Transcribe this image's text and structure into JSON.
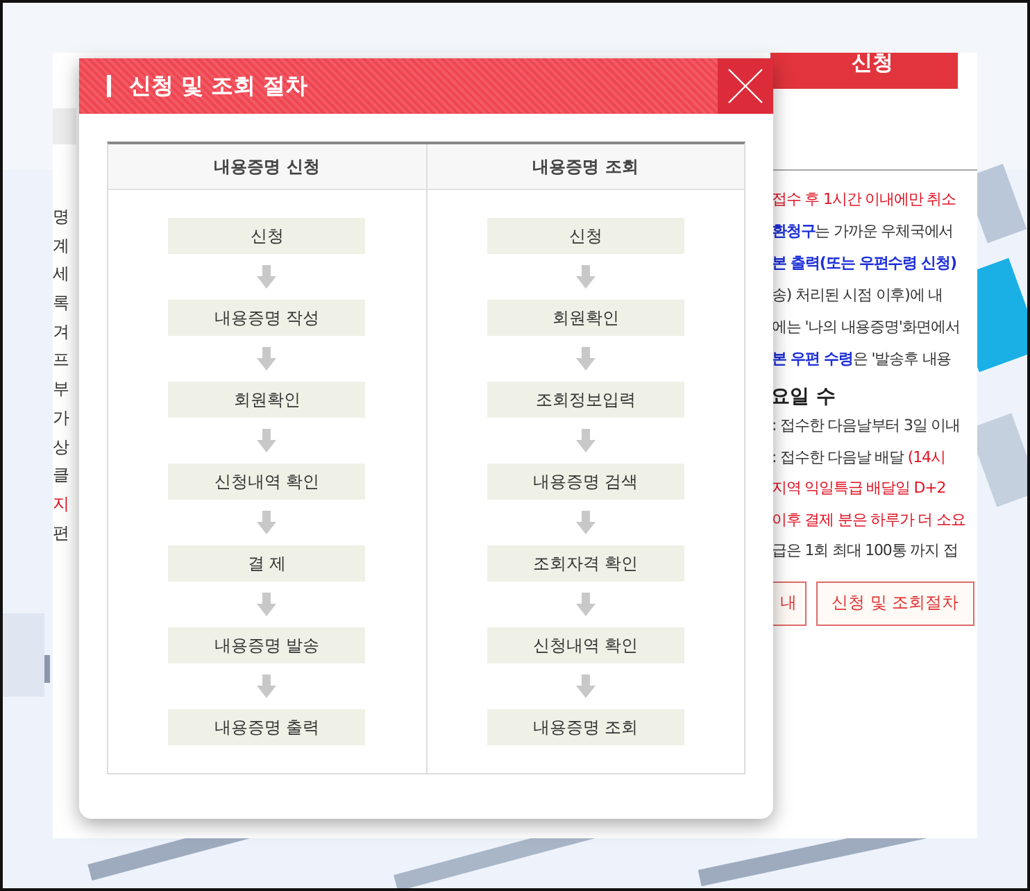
{
  "background_page": {
    "top_button": "신청",
    "left_fragments": [
      {
        "text": "명",
        "color": "#333333"
      },
      {
        "text": "계",
        "color": "#333333"
      },
      {
        "text": "세",
        "color": "#333333"
      },
      {
        "text": "록",
        "color": "#333333"
      },
      {
        "text": "겨",
        "color": "#333333"
      },
      {
        "text": "프",
        "color": "#333333"
      },
      {
        "text": "부",
        "color": "#333333"
      },
      {
        "text": "가",
        "color": "#333333"
      },
      {
        "text": "상",
        "color": "#333333"
      },
      {
        "text": "클",
        "color": "#333333"
      },
      {
        "text": "지",
        "color": "#e01020"
      },
      {
        "text": "편",
        "color": "#333333"
      }
    ],
    "notice_lines": [
      [
        {
          "text": "접수 후 1시간 이내에만 취소",
          "color": "#e01020",
          "bold": false
        }
      ],
      [
        {
          "text": "환청구",
          "color": "#1d2fd8",
          "bold": true
        },
        {
          "text": "는 가까운 우체국에서",
          "color": "#333333",
          "bold": false
        }
      ],
      [
        {
          "text": "본 출력(또는 우편수령 신청)",
          "color": "#1d2fd8",
          "bold": true
        }
      ],
      [
        {
          "text": "송) 처리된 시점 이후)에 내",
          "color": "#333333",
          "bold": false
        }
      ],
      [
        {
          "text": "에는 '나의 내용증명'화면에서",
          "color": "#333333",
          "bold": false
        }
      ],
      [
        {
          "text": "본 우편 수령",
          "color": "#1d2fd8",
          "bold": true
        },
        {
          "text": "은 '발송후 내용",
          "color": "#333333",
          "bold": false
        }
      ]
    ],
    "section_heading": "요일 수",
    "section_lines": [
      [
        {
          "text": ": 접수한 다음날부터 3일 이내",
          "color": "#333333",
          "bold": false
        }
      ],
      [
        {
          "text": ": 접수한 다음날 배달 ",
          "color": "#333333",
          "bold": false
        },
        {
          "text": "(14시",
          "color": "#e01020",
          "bold": false
        }
      ],
      [
        {
          "text": "지역 익일특급 배달일 D+2",
          "color": "#e01020",
          "bold": false
        }
      ],
      [
        {
          "text": "이후 결제 분은 하루가 더 소요",
          "color": "#e01020",
          "bold": false
        }
      ],
      [
        {
          "text": "급은 1회 최대 100통 까지 접",
          "color": "#333333",
          "bold": false
        }
      ]
    ],
    "tab_buttons": [
      "내",
      "신청 및 조회절차"
    ]
  },
  "dialog": {
    "title": "신청 및 조회 절차",
    "columns": [
      {
        "heading": "내용증명 신청",
        "steps": [
          "신청",
          "내용증명 작성",
          "회원확인",
          "신청내역 확인",
          "결 제",
          "내용증명 발송",
          "내용증명 출력"
        ]
      },
      {
        "heading": "내용증명 조회",
        "steps": [
          "신청",
          "회원확인",
          "조회정보입력",
          "내용증명 검색",
          "조회자격 확인",
          "신청내역 확인",
          "내용증명 조회"
        ]
      }
    ]
  }
}
